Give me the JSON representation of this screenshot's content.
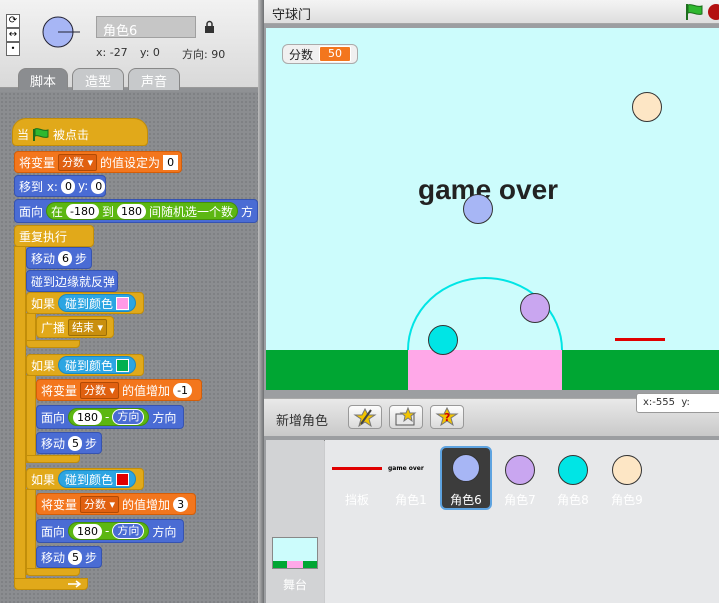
{
  "sprite_header": {
    "name_value": "角色6",
    "x_label": "x:",
    "x_value": "-27",
    "y_label": "y:",
    "y_value": "0",
    "direction_label": "方向:",
    "direction_value": "90"
  },
  "tabs": [
    {
      "label": "脚本"
    },
    {
      "label": "造型"
    },
    {
      "label": "声音"
    }
  ],
  "script": {
    "hat_when": "当",
    "hat_clicked": "被点击",
    "set_var_prefix": "将变量",
    "set_var_name": "分数",
    "set_var_mid": "的值设定为",
    "set_var_value": "0",
    "goto_prefix": "移到 x:",
    "goto_x": "0",
    "goto_y_label": "y:",
    "goto_y": "0",
    "point_prefix": "面向",
    "pick_random_a": "在",
    "pick_random_min": "-180",
    "pick_random_mid": "到",
    "pick_random_max": "180",
    "pick_random_suffix": "间随机选一个数",
    "point_tail": "方",
    "forever": "重复执行",
    "move_label": "移动",
    "move_6": "6",
    "steps": "步",
    "bounce": "碰到边缘就反弹",
    "if_label": "如果",
    "touching_color": "碰到颜色",
    "broadcast_label": "广播",
    "broadcast_value": "结束",
    "change_var_prefix": "将变量",
    "change_var_name": "分数",
    "change_var_mid": "的值增加",
    "change_neg1": "-1",
    "change_3": "3",
    "point_in": "面向",
    "direction_180": "180",
    "minus": "-",
    "direction_rep": "方向",
    "direction_tail": "方向",
    "move_5": "5",
    "colors": {
      "pink": "#ff99e6",
      "green": "#00b050",
      "red": "#e00000"
    }
  },
  "stage": {
    "title": "守球门",
    "var_monitor_label": "分数",
    "var_monitor_value": "50",
    "game_over_text": "game over"
  },
  "coords": {
    "x_label": "x:",
    "x_value": "-555",
    "y_label": "y:"
  },
  "sprites_bar": {
    "label": "新增角色"
  },
  "sprites": [
    {
      "name": "挡板",
      "color": "#e00000"
    },
    {
      "name": "角色1",
      "color": "#000000"
    },
    {
      "name": "角色6",
      "color": "#a7b6f5"
    },
    {
      "name": "角色7",
      "color": "#c9a6f0"
    },
    {
      "name": "角色8",
      "color": "#00e5e5"
    },
    {
      "name": "角色9",
      "color": "#fde6c5"
    }
  ],
  "stage_thumb_label": "舞台",
  "sprite1_thumb_text": "game over"
}
